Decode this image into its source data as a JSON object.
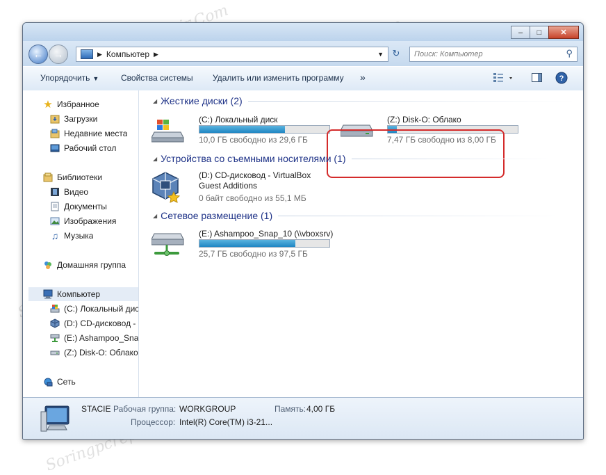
{
  "address": {
    "segment": "Компьютер"
  },
  "search": {
    "placeholder": "Поиск: Компьютер"
  },
  "toolbar": {
    "organize": "Упорядочить",
    "system_props": "Свойства системы",
    "uninstall": "Удалить или изменить программу",
    "more": "»"
  },
  "sidebar": {
    "favorites": "Избранное",
    "downloads": "Загрузки",
    "recent": "Недавние места",
    "desktop": "Рабочий стол",
    "libraries": "Библиотеки",
    "video": "Видео",
    "documents": "Документы",
    "images": "Изображения",
    "music": "Музыка",
    "homegroup": "Домашняя группа",
    "computer": "Компьютер",
    "drive_c": "(C:) Локальный дис",
    "drive_d": "(D:) CD-дисковод - '",
    "drive_e": "(E:) Ashampoo_Snap",
    "drive_z": "(Z:) Disk-O: Облако",
    "network": "Сеть"
  },
  "groups": {
    "hdd": "Жесткие диски (2)",
    "removable": "Устройства со съемными носителями (1)",
    "network": "Сетевое размещение (1)"
  },
  "drives": {
    "c": {
      "name": "(C:) Локальный диск",
      "free": "10,0 ГБ свободно из 29,6 ГБ",
      "used_fraction": 0.66
    },
    "z": {
      "name": "(Z:) Disk-O: Облако",
      "free": "7,47 ГБ свободно из 8,00 ГБ",
      "used_fraction": 0.07
    },
    "d": {
      "name_line1": "(D:) CD-дисковод - VirtualBox",
      "name_line2": "Guest Additions",
      "free": "0 байт свободно из 55,1 МБ"
    },
    "e": {
      "name": "(E:) Ashampoo_Snap_10 (\\\\vboxsrv)",
      "free": "25,7 ГБ свободно из 97,5 ГБ",
      "used_fraction": 0.74
    }
  },
  "details": {
    "computer_name": "STACIE",
    "workgroup_label": "Рабочая группа:",
    "workgroup_value": "WORKGROUP",
    "memory_label": "Память:",
    "memory_value": "4,00 ГБ",
    "cpu_label": "Процессор:",
    "cpu_value": "Intel(R) Core(TM) i3-21..."
  },
  "watermark": "Soringpcrepair.Com",
  "colors": {
    "accent": "#1f86c3",
    "group_heading": "#1e3287",
    "highlight": "#d42b2b"
  }
}
